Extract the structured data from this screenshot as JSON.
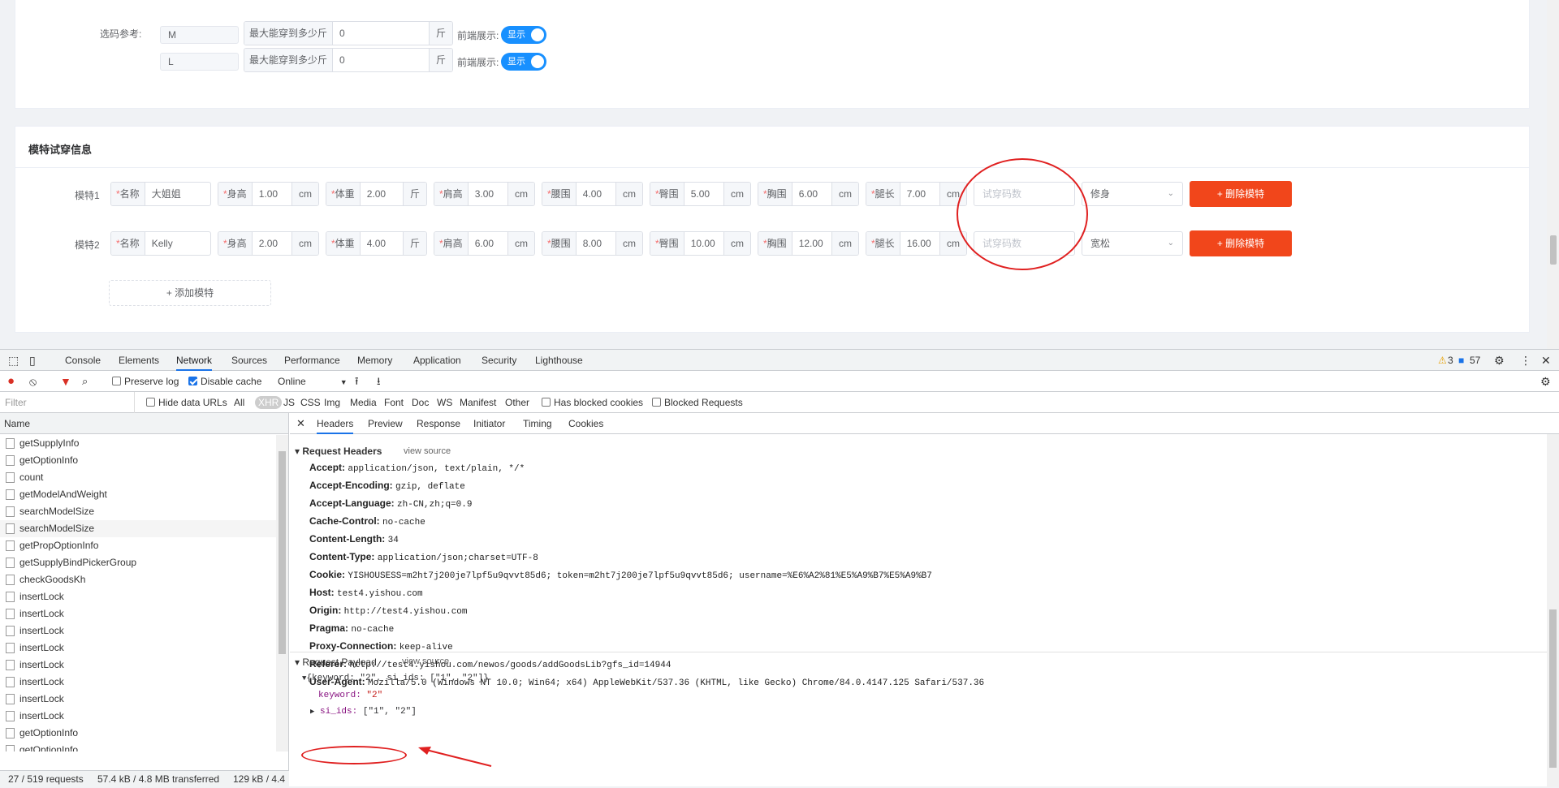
{
  "size_ref": {
    "label": "选码参考:",
    "rows": [
      {
        "size": "M",
        "max_prefix": "最大能穿到多少斤",
        "max_value": "0",
        "unit": "斤",
        "front_label": "前端展示:",
        "switch_text": "显示"
      },
      {
        "size": "L",
        "max_prefix": "最大能穿到多少斤",
        "max_value": "0",
        "unit": "斤",
        "front_label": "前端展示:",
        "switch_text": "显示"
      }
    ]
  },
  "models_section": {
    "title": "模特试穿信息",
    "models": [
      {
        "label": "模特1",
        "fields": [
          {
            "name": "名称",
            "value": "大姐姐",
            "unit": ""
          },
          {
            "name": "身高",
            "value": "1.00",
            "unit": "cm"
          },
          {
            "name": "体重",
            "value": "2.00",
            "unit": "斤"
          },
          {
            "name": "肩高",
            "value": "3.00",
            "unit": "cm"
          },
          {
            "name": "腰围",
            "value": "4.00",
            "unit": "cm"
          },
          {
            "name": "臀围",
            "value": "5.00",
            "unit": "cm"
          },
          {
            "name": "胸围",
            "value": "6.00",
            "unit": "cm"
          },
          {
            "name": "腿长",
            "value": "7.00",
            "unit": "cm"
          }
        ],
        "size_placeholder": "试穿码数",
        "fit": "修身",
        "delete_label": "+ 删除模特"
      },
      {
        "label": "模特2",
        "fields": [
          {
            "name": "名称",
            "value": "Kelly",
            "unit": ""
          },
          {
            "name": "身高",
            "value": "2.00",
            "unit": "cm"
          },
          {
            "name": "体重",
            "value": "4.00",
            "unit": "斤"
          },
          {
            "name": "肩高",
            "value": "6.00",
            "unit": "cm"
          },
          {
            "name": "腰围",
            "value": "8.00",
            "unit": "cm"
          },
          {
            "name": "臀围",
            "value": "10.00",
            "unit": "cm"
          },
          {
            "name": "胸围",
            "value": "12.00",
            "unit": "cm"
          },
          {
            "name": "腿长",
            "value": "16.00",
            "unit": "cm"
          }
        ],
        "size_placeholder": "试穿码数",
        "fit": "宽松",
        "delete_label": "+ 删除模特"
      }
    ],
    "add_label": "+ 添加模特"
  },
  "devtools": {
    "tabs": [
      "Console",
      "Elements",
      "Network",
      "Sources",
      "Performance",
      "Memory",
      "Application",
      "Security",
      "Lighthouse"
    ],
    "active_tab": "Network",
    "warnings": "3",
    "messages": "57",
    "toolbar": {
      "preserve_log": "Preserve log",
      "disable_cache": "Disable cache",
      "throttle": "Online"
    },
    "filter": {
      "placeholder": "Filter",
      "hide_data_urls": "Hide data URLs",
      "types": [
        "All",
        "XHR",
        "JS",
        "CSS",
        "Img",
        "Media",
        "Font",
        "Doc",
        "WS",
        "Manifest",
        "Other"
      ],
      "has_blocked": "Has blocked cookies",
      "blocked_requests": "Blocked Requests"
    },
    "name_header": "Name",
    "requests": [
      "getSupplyInfo",
      "getOptionInfo",
      "count",
      "getModelAndWeight",
      "searchModelSize",
      "searchModelSize",
      "getPropOptionInfo",
      "getSupplyBindPickerGroup",
      "checkGoodsKh",
      "insertLock",
      "insertLock",
      "insertLock",
      "insertLock",
      "insertLock",
      "insertLock",
      "insertLock",
      "insertLock",
      "getOptionInfo",
      "getOptionInfo"
    ],
    "status": {
      "requests": "27 / 519 requests",
      "transferred": "57.4 kB / 4.8 MB transferred",
      "resources": "129 kB / 4.4"
    },
    "detail_tabs": [
      "Headers",
      "Preview",
      "Response",
      "Initiator",
      "Timing",
      "Cookies"
    ],
    "request_headers_title": "Request Headers",
    "view_source": "view source",
    "headers": [
      {
        "k": "Accept:",
        "v": "application/json, text/plain, */*"
      },
      {
        "k": "Accept-Encoding:",
        "v": "gzip, deflate"
      },
      {
        "k": "Accept-Language:",
        "v": "zh-CN,zh;q=0.9"
      },
      {
        "k": "Cache-Control:",
        "v": "no-cache"
      },
      {
        "k": "Content-Length:",
        "v": "34"
      },
      {
        "k": "Content-Type:",
        "v": "application/json;charset=UTF-8"
      },
      {
        "k": "Cookie:",
        "v": "YISHOUSESS=m2ht7j200je7lpf5u9qvvt85d6; token=m2ht7j200je7lpf5u9qvvt85d6; username=%E6%A2%81%E5%A9%B7%E5%A9%B7"
      },
      {
        "k": "Host:",
        "v": "test4.yishou.com"
      },
      {
        "k": "Origin:",
        "v": "http://test4.yishou.com"
      },
      {
        "k": "Pragma:",
        "v": "no-cache"
      },
      {
        "k": "Proxy-Connection:",
        "v": "keep-alive"
      },
      {
        "k": "Referer:",
        "v": "http://test4.yishou.com/newos/goods/addGoodsLib?gfs_id=14944"
      },
      {
        "k": "User-Agent:",
        "v": "Mozilla/5.0 (Windows NT 10.0; Win64; x64) AppleWebKit/537.36 (KHTML, like Gecko) Chrome/84.0.4147.125 Safari/537.36"
      }
    ],
    "payload_title": "Request Payload",
    "payload_summary": "{keyword: \"2\", si_ids: [\"1\", \"2\"]}",
    "payload_keyword_key": "keyword:",
    "payload_keyword_val": "\"2\"",
    "payload_siids_key": "si_ids:",
    "payload_siids_val": "[\"1\", \"2\"]"
  }
}
